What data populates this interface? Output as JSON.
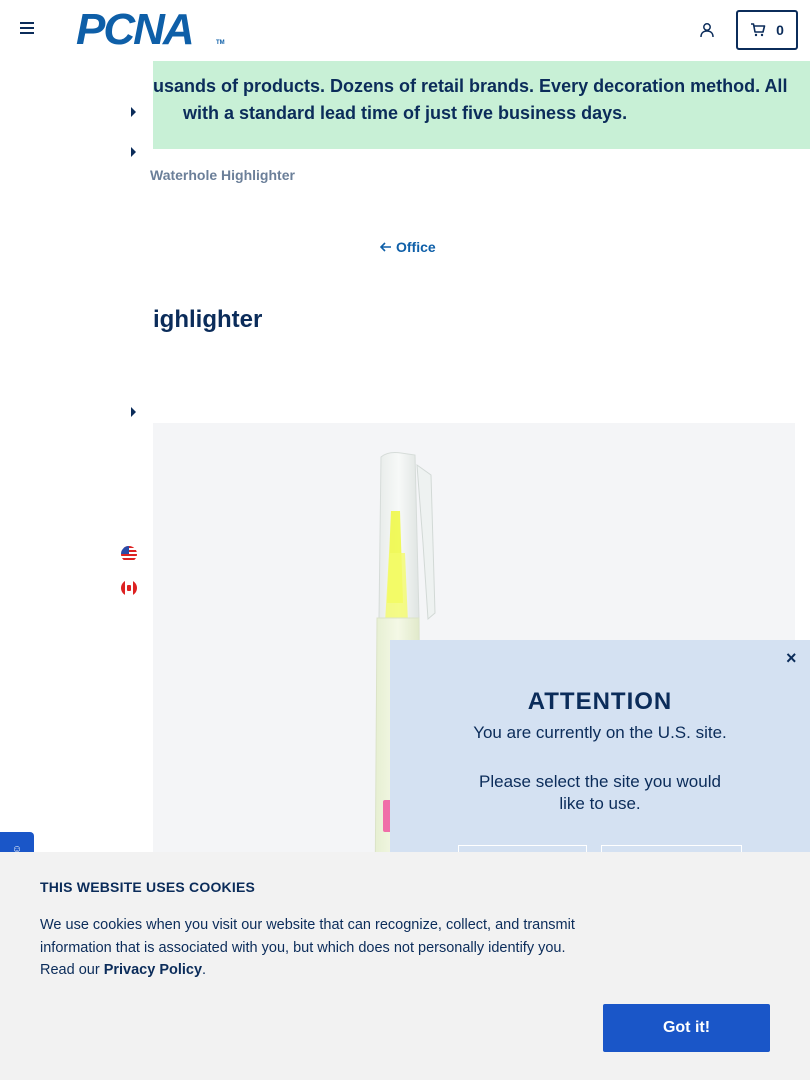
{
  "header": {
    "logo_text": "PCNA",
    "logo_tm": "TM",
    "cart_count": "0"
  },
  "banner": {
    "line1": "usands of products. Dozens of retail brands. Every decoration method. All",
    "line2": "with a standard lead time of just five business days."
  },
  "breadcrumb": {
    "current": "Waterhole Highlighter"
  },
  "back_link": {
    "label": "Office"
  },
  "product": {
    "title": "ighlighter"
  },
  "modal": {
    "close": "×",
    "title": "ATTENTION",
    "message": "You are currently on the U.S. site.",
    "prompt": "Please select the site you would like to use."
  },
  "cookie": {
    "title": "THIS WEBSITE USES COOKIES",
    "body": "We use cookies when you visit our website that can recognize, collect, and transmit information that is associated with you, but which does not personally identify you. Read our ",
    "link": "Privacy Policy",
    "period": ".",
    "button": "Got it!"
  },
  "colors": {
    "navy": "#0b2c5a",
    "brand_blue": "#0e5fa8",
    "banner_green": "#c8f0d6",
    "modal_blue": "#d4e1f2",
    "button_blue": "#1a56c8"
  },
  "icons": {
    "menu": "hamburger-icon",
    "account": "user-icon",
    "cart": "cart-icon",
    "back": "arrow-left-icon",
    "feedback": "feedback-icon"
  }
}
